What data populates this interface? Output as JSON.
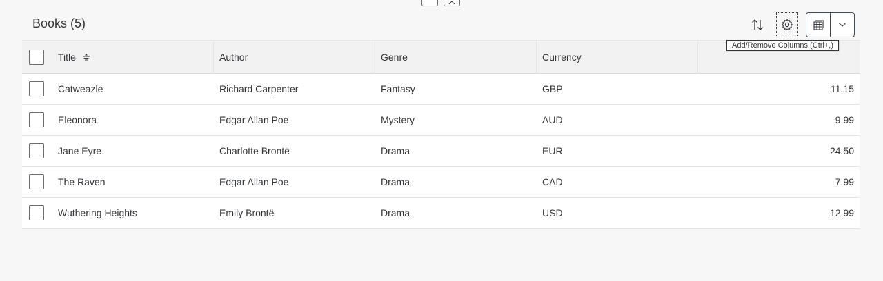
{
  "table": {
    "title": "Books (5)",
    "columns": {
      "title": "Title",
      "author": "Author",
      "genre": "Genre",
      "currency": "Currency",
      "price": ""
    },
    "rows": [
      {
        "title": "Catweazle",
        "author": "Richard Carpenter",
        "genre": "Fantasy",
        "currency": "GBP",
        "price": "11.15"
      },
      {
        "title": "Eleonora",
        "author": "Edgar Allan Poe",
        "genre": "Mystery",
        "currency": "AUD",
        "price": "9.99"
      },
      {
        "title": "Jane Eyre",
        "author": "Charlotte Brontë",
        "genre": "Drama",
        "currency": "EUR",
        "price": "24.50"
      },
      {
        "title": "The Raven",
        "author": "Edgar Allan Poe",
        "genre": "Drama",
        "currency": "CAD",
        "price": "7.99"
      },
      {
        "title": "Wuthering Heights",
        "author": "Emily Brontë",
        "genre": "Drama",
        "currency": "USD",
        "price": "12.99"
      }
    ]
  },
  "toolbar": {
    "sort_icon": "sort-icon",
    "settings_icon": "gear-icon",
    "group_icon": "table-group-icon",
    "dropdown_icon": "chevron-down-icon",
    "tooltip": "Add/Remove Columns (Ctrl+,)"
  },
  "colors": {
    "background": "#f7f7f7",
    "header_row": "#f2f2f2",
    "text": "#32363a",
    "border": "#e5e5e5"
  }
}
